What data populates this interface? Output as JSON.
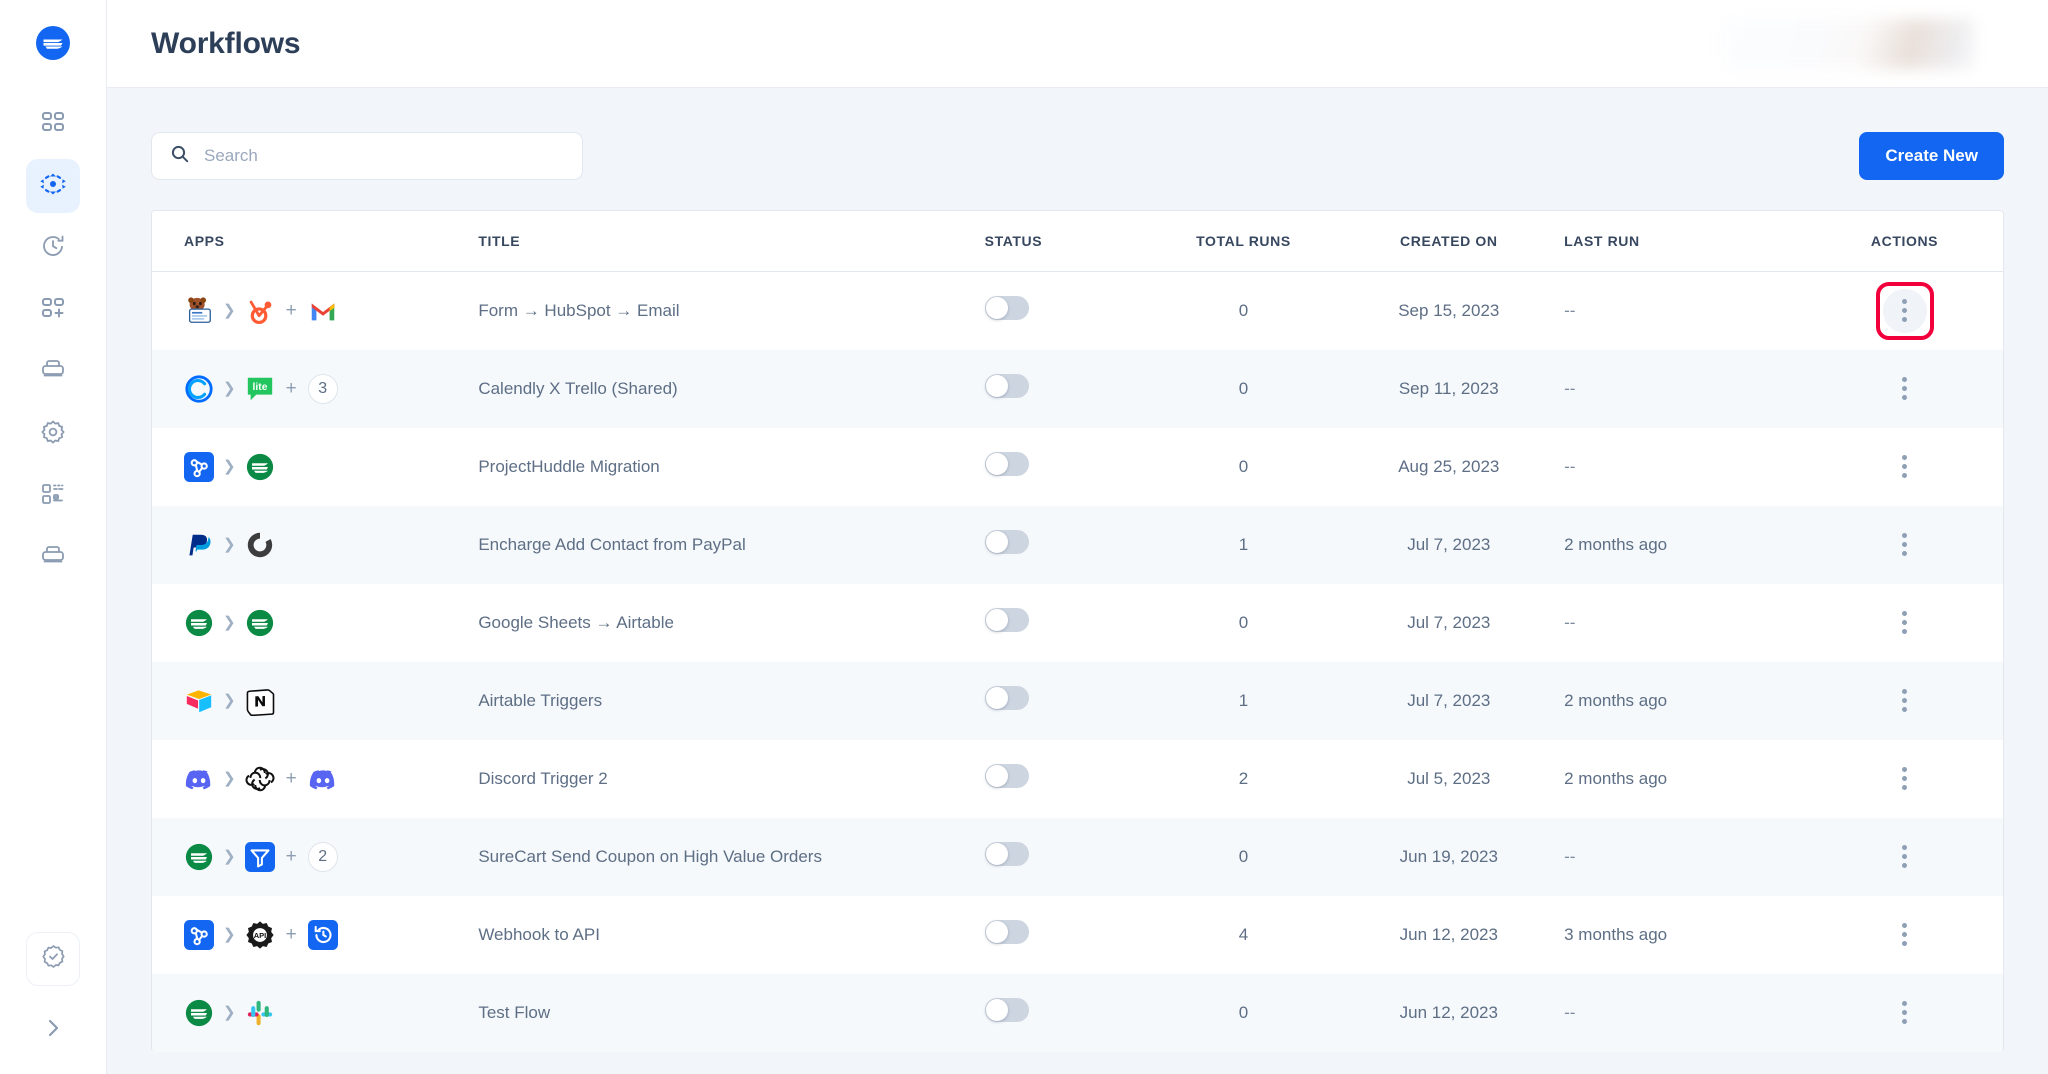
{
  "app": {
    "brand_icon": "suretriggers-logo-icon",
    "accent_color": "#1266f1",
    "highlight_color": "#f2003c"
  },
  "sidebar": {
    "items": [
      {
        "name": "dashboard",
        "icon": "grid-icon",
        "active": false
      },
      {
        "name": "workflows",
        "icon": "workflow-nodes-icon",
        "active": true
      },
      {
        "name": "history",
        "icon": "clock-history-icon",
        "active": false
      },
      {
        "name": "add-app",
        "icon": "grid-plus-icon",
        "active": false
      },
      {
        "name": "apps",
        "icon": "stack-icon",
        "active": false
      },
      {
        "name": "settings",
        "icon": "gear-icon",
        "active": false
      },
      {
        "name": "integrations",
        "icon": "blocks-list-icon",
        "active": false
      },
      {
        "name": "storage",
        "icon": "stack-icon",
        "active": false
      }
    ],
    "bottom": {
      "badge_icon": "verified-badge-icon",
      "expand_icon": "chevron-right-icon"
    }
  },
  "header": {
    "title": "Workflows",
    "account_chip": "blurred-account-area"
  },
  "toolbar": {
    "search_placeholder": "Search",
    "search_value": "",
    "search_icon": "search-icon",
    "create_label": "Create New"
  },
  "table": {
    "columns": [
      "APPS",
      "TITLE",
      "STATUS",
      "TOTAL RUNS",
      "CREATED ON",
      "LAST RUN",
      "ACTIONS"
    ],
    "rows": [
      {
        "apps": [
          "wpforms",
          "hubspot",
          "gmail"
        ],
        "extra_count": null,
        "title": "Form → HubSpot → Email",
        "status_on": false,
        "total_runs": "0",
        "created_on": "Sep 15, 2023",
        "last_run": "--",
        "action_icon": "kebab-menu-icon",
        "highlighted": true
      },
      {
        "apps": [
          "calendly",
          "trello-lite"
        ],
        "extra_count": "3",
        "title": "Calendly X Trello (Shared)",
        "status_on": false,
        "total_runs": "0",
        "created_on": "Sep 11, 2023",
        "last_run": "--",
        "action_icon": "kebab-menu-icon",
        "highlighted": false
      },
      {
        "apps": [
          "webhook",
          "suretriggers"
        ],
        "extra_count": null,
        "title": "ProjectHuddle Migration",
        "status_on": false,
        "total_runs": "0",
        "created_on": "Aug 25, 2023",
        "last_run": "--",
        "action_icon": "kebab-menu-icon",
        "highlighted": false
      },
      {
        "apps": [
          "paypal",
          "encharge"
        ],
        "extra_count": null,
        "title": "Encharge Add Contact from PayPal",
        "status_on": false,
        "total_runs": "1",
        "created_on": "Jul 7, 2023",
        "last_run": "2 months ago",
        "action_icon": "kebab-menu-icon",
        "highlighted": false
      },
      {
        "apps": [
          "suretriggers",
          "suretriggers"
        ],
        "extra_count": null,
        "title": "Google Sheets → Airtable",
        "status_on": false,
        "total_runs": "0",
        "created_on": "Jul 7, 2023",
        "last_run": "--",
        "action_icon": "kebab-menu-icon",
        "highlighted": false
      },
      {
        "apps": [
          "airtable",
          "notion"
        ],
        "extra_count": null,
        "title": "Airtable Triggers",
        "status_on": false,
        "total_runs": "1",
        "created_on": "Jul 7, 2023",
        "last_run": "2 months ago",
        "action_icon": "kebab-menu-icon",
        "highlighted": false
      },
      {
        "apps": [
          "discord",
          "openai",
          "discord"
        ],
        "extra_count": null,
        "title": "Discord Trigger 2",
        "status_on": false,
        "total_runs": "2",
        "created_on": "Jul 5, 2023",
        "last_run": "2 months ago",
        "action_icon": "kebab-menu-icon",
        "highlighted": false
      },
      {
        "apps": [
          "suretriggers",
          "filter"
        ],
        "extra_count": "2",
        "title": "SureCart Send Coupon on High Value Orders",
        "status_on": false,
        "total_runs": "0",
        "created_on": "Jun 19, 2023",
        "last_run": "--",
        "action_icon": "kebab-menu-icon",
        "highlighted": false
      },
      {
        "apps": [
          "webhook",
          "api",
          "delay"
        ],
        "extra_count": null,
        "title": "Webhook to API",
        "status_on": false,
        "total_runs": "4",
        "created_on": "Jun 12, 2023",
        "last_run": "3 months ago",
        "action_icon": "kebab-menu-icon",
        "highlighted": false
      },
      {
        "apps": [
          "suretriggers",
          "slack"
        ],
        "extra_count": null,
        "title": "Test Flow",
        "status_on": false,
        "total_runs": "0",
        "created_on": "Jun 12, 2023",
        "last_run": "--",
        "action_icon": "kebab-menu-icon",
        "highlighted": false
      }
    ]
  }
}
